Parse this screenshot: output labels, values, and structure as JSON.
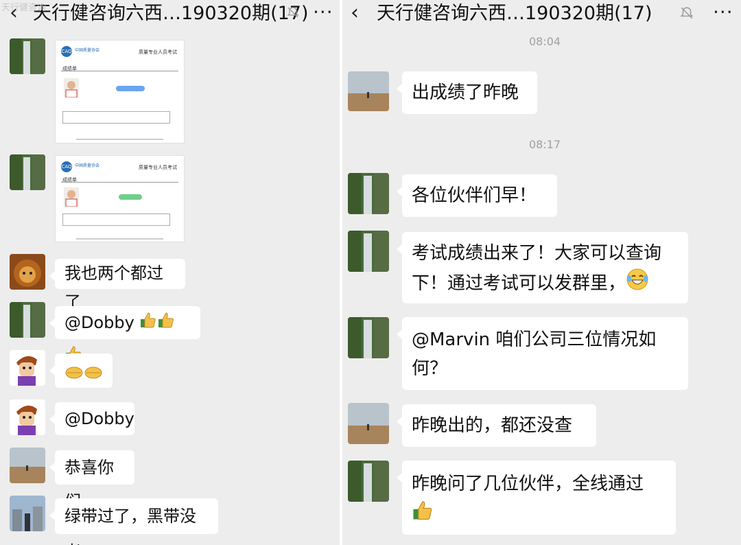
{
  "watermark": "天行健咨询",
  "left": {
    "title": "天行健咨询六西…190320期(17)",
    "back_icon": "‹",
    "more_icon": "···",
    "messages": [
      {
        "type": "image",
        "sender_avatar": "waterfall-avatar"
      },
      {
        "type": "image",
        "sender_avatar": "waterfall-avatar"
      },
      {
        "type": "text",
        "sender_avatar": "lion-avatar",
        "text": "我也两个都过了"
      },
      {
        "type": "text",
        "sender_avatar": "waterfall-avatar",
        "text": "@Dobby",
        "emoji": [
          "thumbs-up",
          "thumbs-up",
          "thumbs-up"
        ]
      },
      {
        "type": "emoji",
        "sender_avatar": "cartoon-man-avatar",
        "emoji": [
          "handshake",
          "handshake"
        ]
      },
      {
        "type": "text",
        "sender_avatar": "cartoon-man-avatar",
        "text": "@Dobby"
      },
      {
        "type": "text",
        "sender_avatar": "desert-avatar",
        "text": "恭喜你们"
      },
      {
        "type": "text",
        "sender_avatar": "city-avatar",
        "text": "绿带过了，黑带没考"
      }
    ],
    "cert": {
      "org": "中国质量协会",
      "title": "质量专业人员考试",
      "name": "成绩单"
    }
  },
  "right": {
    "title": "天行健咨询六西…190320期(17)",
    "back_icon": "‹",
    "more_icon": "···",
    "times": [
      "08:04",
      "08:17"
    ],
    "messages": [
      {
        "sender_avatar": "desert-avatar",
        "lines": [
          "出成绩了昨晚"
        ]
      },
      {
        "sender_avatar": "waterfall-avatar",
        "lines": [
          "各位伙伴们早！"
        ]
      },
      {
        "sender_avatar": "waterfall-avatar",
        "lines": [
          "考试成绩出来了！大家可以查询",
          "下！通过考试可以发群里，"
        ],
        "emoji": "laughing-tears"
      },
      {
        "sender_avatar": "waterfall-avatar",
        "lines": [
          "@Marvin  咱们公司三位情况如",
          "何？"
        ]
      },
      {
        "sender_avatar": "desert-avatar",
        "lines": [
          "昨晚出的，都还没查"
        ]
      },
      {
        "sender_avatar": "waterfall-avatar",
        "lines": [
          "昨晚问了几位伙伴，全线通过"
        ],
        "emoji": "thumbs-up"
      }
    ]
  },
  "colors": {
    "chat_bg": "#ededed",
    "bubble_bg": "#ffffff",
    "text": "#111111",
    "time": "#a0a0a0"
  }
}
